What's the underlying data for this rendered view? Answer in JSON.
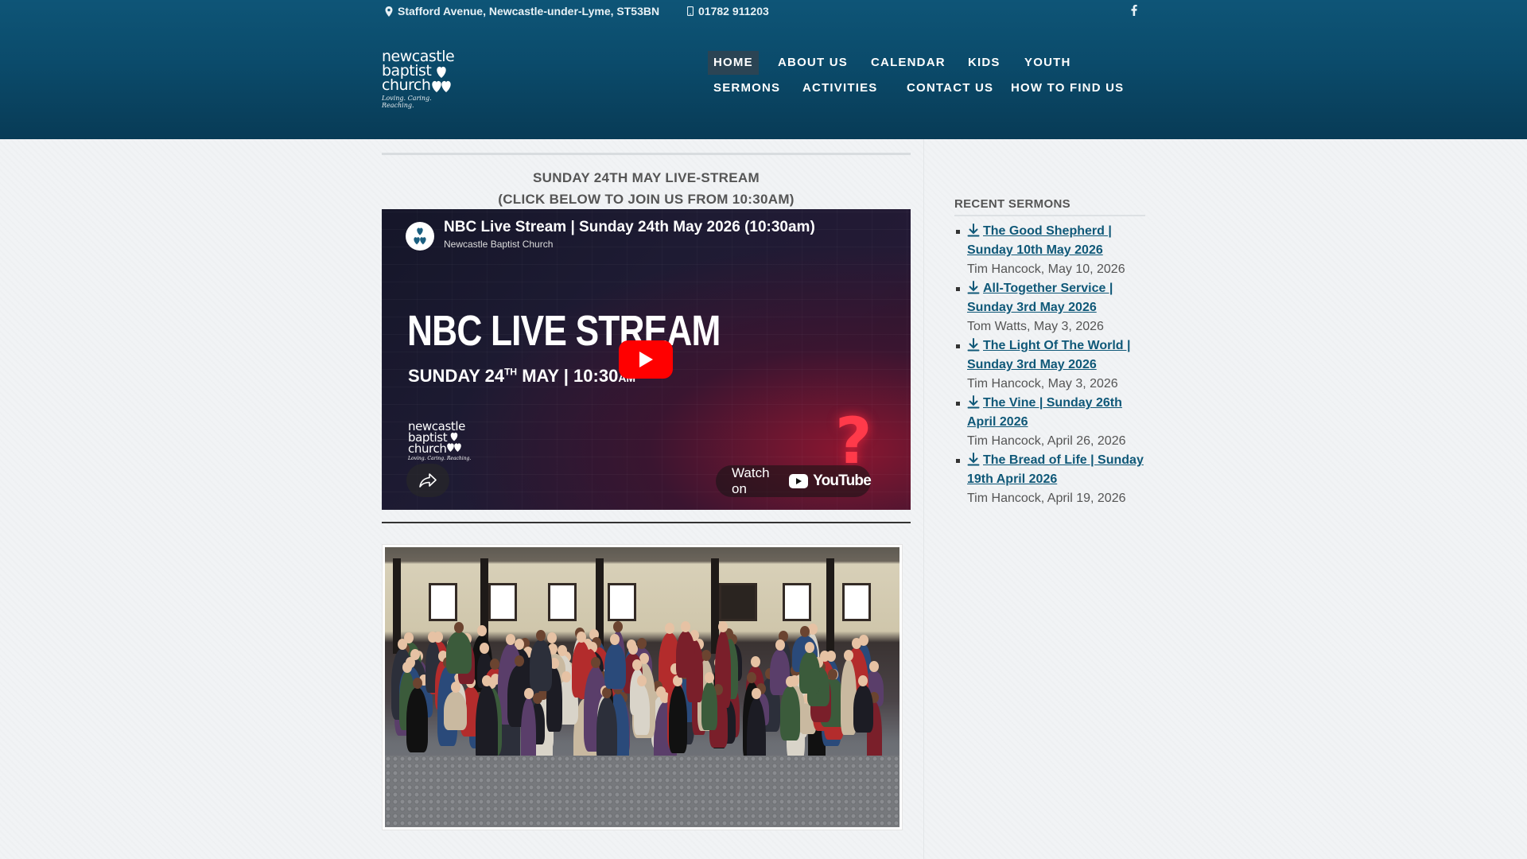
{
  "topbar": {
    "address": "Stafford Avenue, Newcastle-under-Lyme, ST53BN",
    "phone": "01782 911203",
    "facebook_icon": "facebook-icon"
  },
  "logo": {
    "line1": "newcastle",
    "line2": "baptist",
    "line3": "church",
    "tagline": "Loving. Caring. Reaching."
  },
  "nav": {
    "row1": [
      "HOME",
      "ABOUT US",
      "CALENDAR",
      "KIDS",
      "YOUTH"
    ],
    "row2": [
      "SERMONS",
      "ACTIVITIES",
      "CONTACT US",
      "HOW TO FIND US"
    ],
    "active": "HOME"
  },
  "main": {
    "headline_line1": "SUNDAY 24TH MAY LIVE-STREAM",
    "headline_line2": "(CLICK BELOW TO JOIN US FROM 10:30AM)",
    "video": {
      "title": "NBC Live Stream | Sunday 24th May 2026 (10:30am)",
      "channel": "Newcastle Baptist Church",
      "overlay_title": "NBC LIVE STREAM",
      "overlay_date_prefix": "SUNDAY 24",
      "overlay_date_sup": "TH",
      "overlay_date_suffix": " MAY | 10:30",
      "overlay_date_ampm": "AM",
      "watch_on": "Watch on",
      "youtube_word": "YouTube"
    }
  },
  "sidebar": {
    "heading": "RECENT SERMONS",
    "sermons": [
      {
        "title": "The Good Shepherd | Sunday 10th May 2026",
        "meta": "Tim Hancock, May 10, 2026"
      },
      {
        "title": "All-Together Service | Sunday 3rd May 2026",
        "meta": "Tom Watts, May 3, 2026"
      },
      {
        "title": "The Light Of The World | Sunday 3rd May 2026",
        "meta": "Tim Hancock, May 3, 2026"
      },
      {
        "title": "The Vine | Sunday 26th April 2026",
        "meta": "Tim Hancock, April 26, 2026"
      },
      {
        "title": "The Bread of Life | Sunday 19th April 2026",
        "meta": "Tim Hancock, April 19, 2026"
      }
    ]
  },
  "colors": {
    "header": "#0b4b6b",
    "link": "#0f5878",
    "nav_active": "#2b4454",
    "youtube_red": "#ff0000"
  }
}
